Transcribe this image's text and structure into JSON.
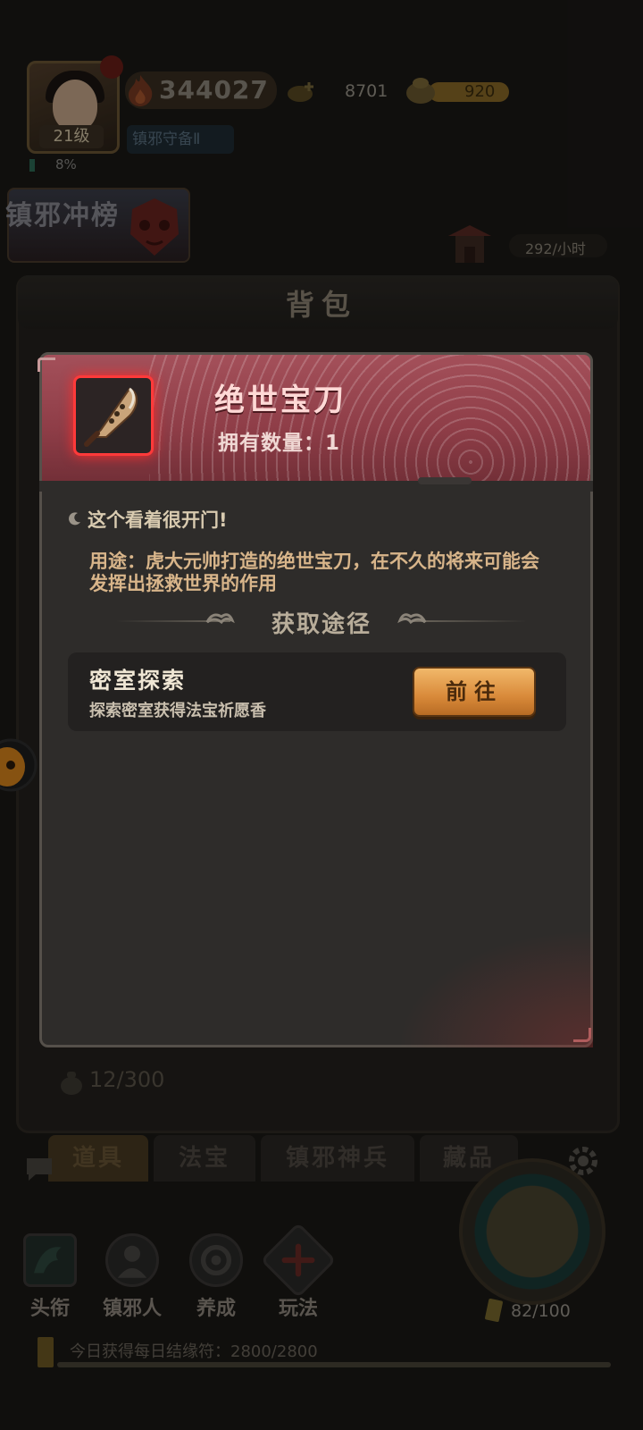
{
  "hud": {
    "level": "21级",
    "exp_percent": "8%",
    "power": "344027",
    "title_tag": "镇邪守备Ⅱ",
    "coins": "8701",
    "gold": "920",
    "rank_banner": "镇邪冲榜",
    "income_rate": "292/小时"
  },
  "bag": {
    "title": "背包",
    "capacity": "12/300",
    "tabs": [
      {
        "label": "道具",
        "active": true
      },
      {
        "label": "法宝",
        "active": false
      },
      {
        "label": "镇邪神兵",
        "active": false
      },
      {
        "label": "藏品",
        "active": false
      }
    ]
  },
  "item_dialog": {
    "name": "绝世宝刀",
    "own_count": "拥有数量：1",
    "flavor": "这个看着很开门!",
    "usage": "用途：虎大元帅打造的绝世宝刀，在不久的将来可能会发挥出拯救世界的作用",
    "source_heading": "获取途径",
    "sources": [
      {
        "title": "密室探索",
        "desc": "探索密室获得法宝祈愿香",
        "button": "前往"
      }
    ]
  },
  "bottom_nav": {
    "items": [
      {
        "label": "头衔"
      },
      {
        "label": "镇邪人"
      },
      {
        "label": "养成"
      },
      {
        "label": "玩法"
      }
    ],
    "energy": "82/100",
    "daily_talisman": "今日获得每日结缘符：2800/2800"
  },
  "colors": {
    "dialog_header": "#8e3d47",
    "go_button": "#d98a3a",
    "rarity_glow": "#ff2a2a"
  }
}
